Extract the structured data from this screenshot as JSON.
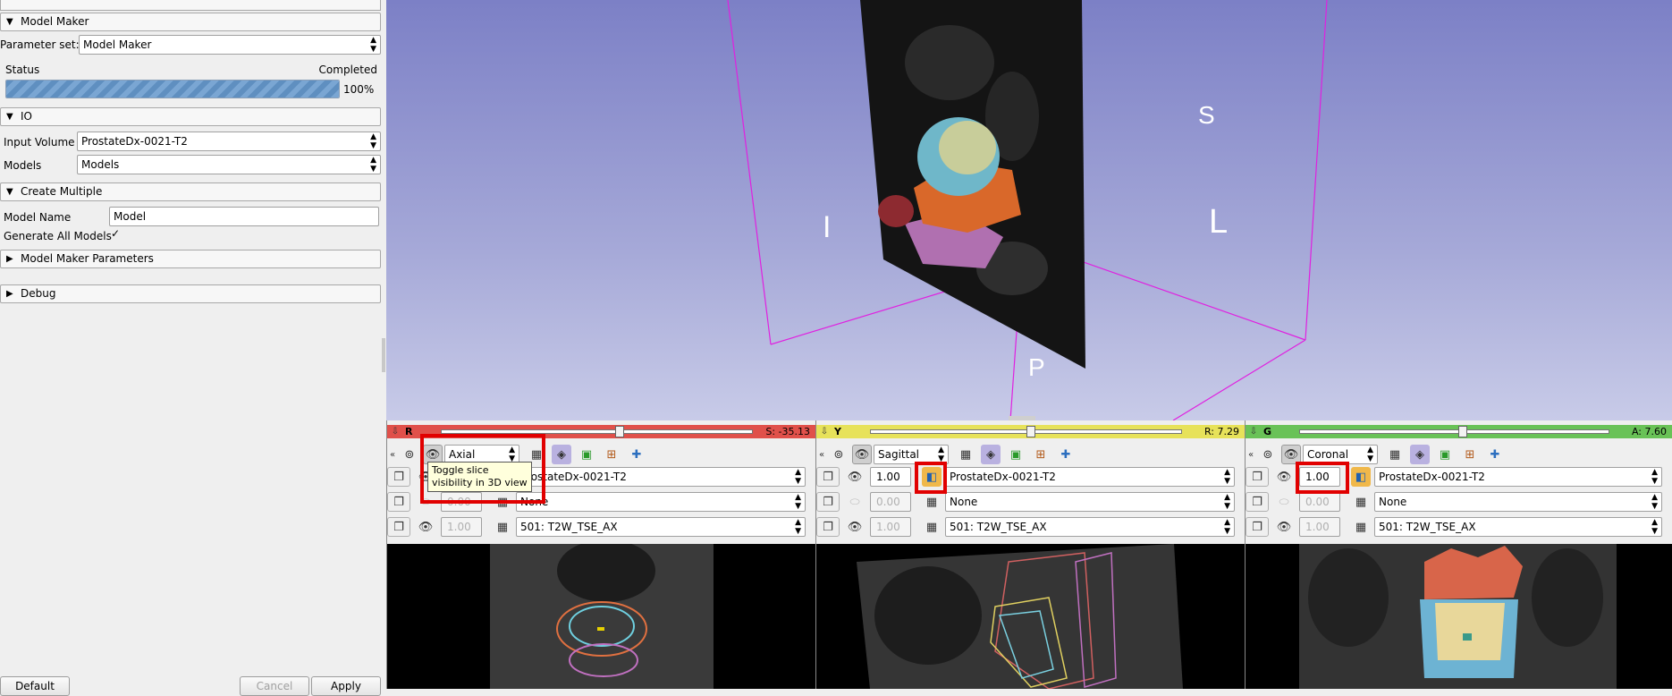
{
  "left": {
    "model_maker_title": "Model Maker",
    "parameter_set_label": "Parameter set:",
    "parameter_set_value": "Model Maker",
    "status_label": "Status",
    "status_value": "Completed",
    "progress_percent": "100%",
    "progress_fraction": 1.0,
    "io_title": "IO",
    "input_volume_label": "Input Volume",
    "input_volume_value": "ProstateDx-0021-T2",
    "models_label": "Models",
    "models_value": "Models",
    "create_multiple_title": "Create Multiple",
    "model_name_label": "Model Name",
    "model_name_value": "Model",
    "generate_all_label": "Generate All Models",
    "generate_all_checked": true,
    "params_title": "Model Maker Parameters",
    "debug_title": "Debug",
    "default_btn": "Default",
    "cancel_btn": "Cancel",
    "apply_btn": "Apply"
  },
  "view3d": {
    "label_s": "S",
    "label_i": "I",
    "label_l": "L",
    "label_p": "P"
  },
  "views": [
    {
      "letter": "R",
      "color": "#e0504a",
      "value": "S: -35.13",
      "orientation": "Axial",
      "fg_opacity": "",
      "fg": "ProstateDx-0021-T2",
      "label_opacity": "0.00",
      "label": "None",
      "bg_opacity": "1.00",
      "bg": "501: T2W_TSE_AX"
    },
    {
      "letter": "Y",
      "color": "#e7e25a",
      "value": "R: 7.29",
      "orientation": "Sagittal",
      "fg_opacity": "1.00",
      "fg": "ProstateDx-0021-T2",
      "label_opacity": "0.00",
      "label": "None",
      "bg_opacity": "1.00",
      "bg": "501: T2W_TSE_AX"
    },
    {
      "letter": "G",
      "color": "#69c257",
      "value": "A: 7.60",
      "orientation": "Coronal",
      "fg_opacity": "1.00",
      "fg": "ProstateDx-0021-T2",
      "label_opacity": "0.00",
      "label": "None",
      "bg_opacity": "1.00",
      "bg": "501: T2W_TSE_AX"
    }
  ],
  "tooltip": {
    "line1": "Toggle slice",
    "line2": "visibility in 3D view"
  },
  "icons": [
    "eye-icon",
    "link-icon",
    "layers-icon",
    "grid-icon",
    "label-icon",
    "reformat-icon",
    "crosshair-icon",
    "collapse-icon"
  ]
}
